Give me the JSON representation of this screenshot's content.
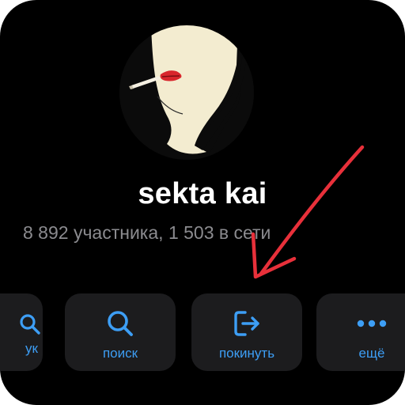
{
  "group": {
    "name": "sekta kai",
    "members_line": "8 892 участника, 1 503 в сети"
  },
  "actions": [
    {
      "label": "ук",
      "icon": "search-icon"
    },
    {
      "label": "поиск",
      "icon": "search-icon"
    },
    {
      "label": "покинуть",
      "icon": "leave-icon"
    },
    {
      "label": "ещё",
      "icon": "more-icon"
    }
  ],
  "colors": {
    "background": "#000000",
    "button_bg": "#1c1c1e",
    "accent": "#3d9ef5",
    "secondary_text": "#8b8b8f",
    "annotation_arrow": "#e8303a"
  }
}
